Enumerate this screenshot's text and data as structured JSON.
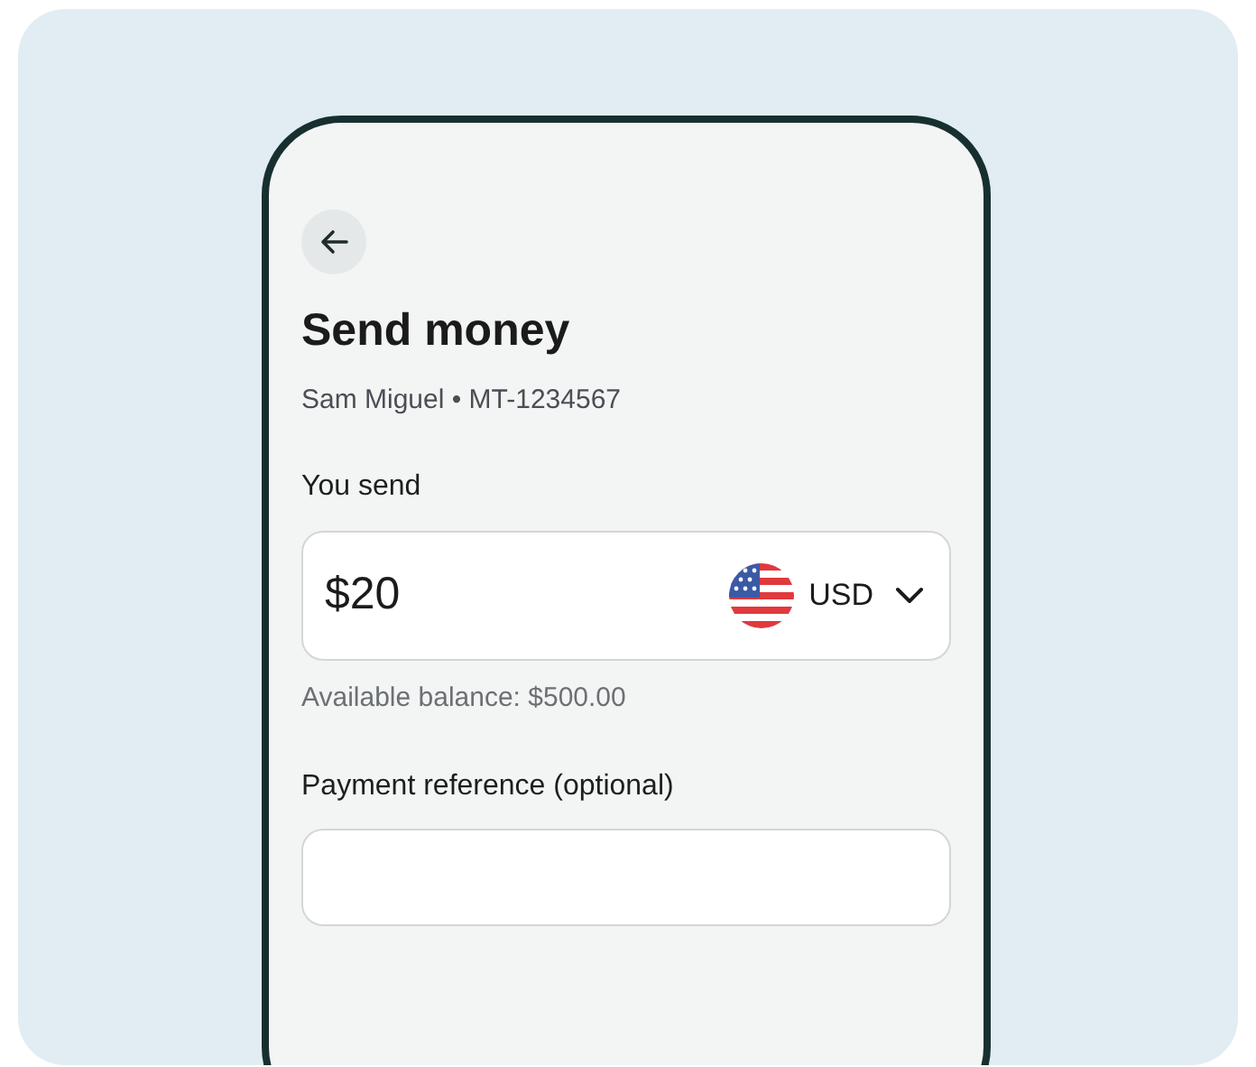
{
  "screen": {
    "title": "Send money",
    "recipient": "Sam Miguel • MT-1234567",
    "amount": {
      "label": "You send",
      "value": "$20",
      "currency": "USD",
      "balance": "Available balance: $500.00"
    },
    "reference": {
      "label": "Payment reference (optional)"
    }
  }
}
